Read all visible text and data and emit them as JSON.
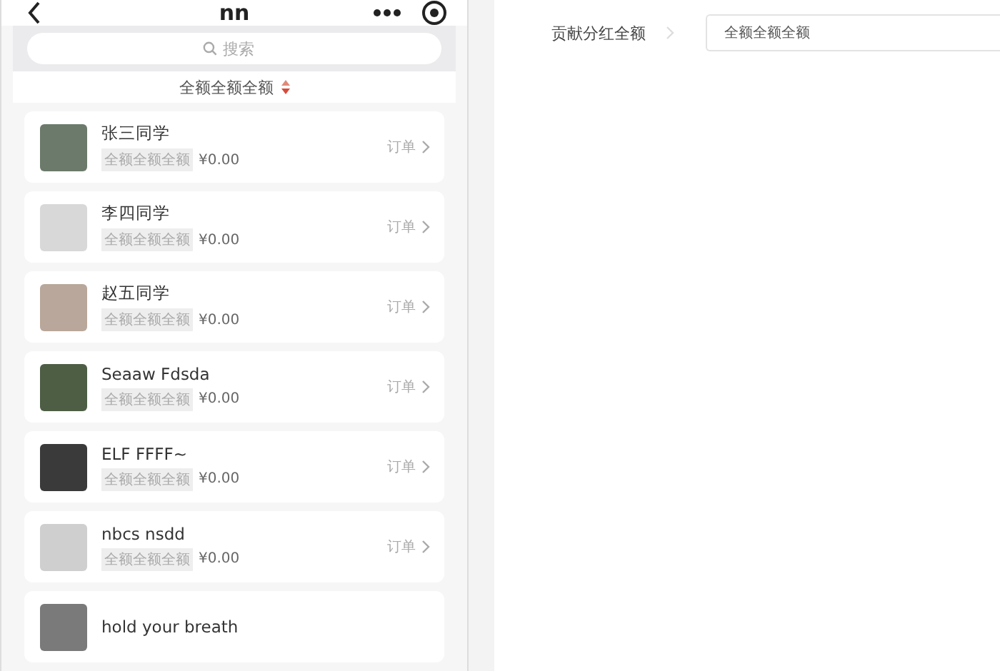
{
  "header": {
    "title": "nn"
  },
  "search": {
    "placeholder": "搜索"
  },
  "sort": {
    "label": "全额全额全额"
  },
  "members": [
    {
      "name": "张三同学",
      "tag": "全额全额全额",
      "amount": "¥0.00",
      "link": "订单"
    },
    {
      "name": "李四同学",
      "tag": "全额全额全额",
      "amount": "¥0.00",
      "link": "订单"
    },
    {
      "name": "赵五同学",
      "tag": "全额全额全额",
      "amount": "¥0.00",
      "link": "订单"
    },
    {
      "name": "Seaaw Fdsda",
      "tag": "全额全额全额",
      "amount": "¥0.00",
      "link": "订单"
    },
    {
      "name": "ELF FFFF~",
      "tag": "全额全额全额",
      "amount": "¥0.00",
      "link": "订单"
    },
    {
      "name": "nbcs nsdd",
      "tag": "全额全额全额",
      "amount": "¥0.00",
      "link": "订单"
    },
    {
      "name": "hold your breath"
    }
  ],
  "form": {
    "label": "贡献分红全额",
    "value": "全额全额全额"
  }
}
